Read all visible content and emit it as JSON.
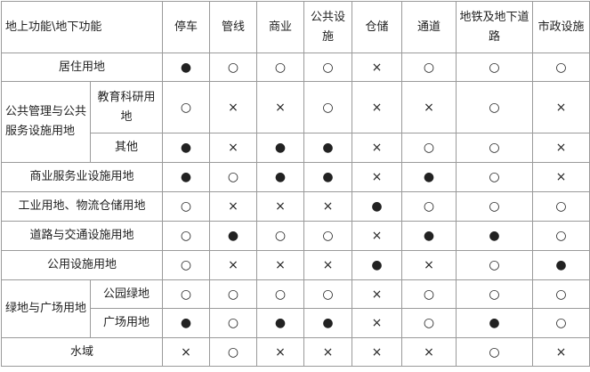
{
  "header": {
    "corner": "地上功能\\地下功能",
    "columns": [
      "停车",
      "管线",
      "商业",
      "公共设施",
      "仓储",
      "通道",
      "地铁及地下道路",
      "市政设施"
    ]
  },
  "groups": {
    "public": "公共管理与公共服务设施用地",
    "green": "绿地与广场用地"
  },
  "rows": [
    {
      "label": "居住用地",
      "marks": [
        "●",
        "○",
        "○",
        "○",
        "×",
        "○",
        "○",
        "○"
      ]
    },
    {
      "label": "教育科研用地",
      "marks": [
        "○",
        "×",
        "×",
        "○",
        "×",
        "×",
        "○",
        "×"
      ]
    },
    {
      "label": "其他",
      "marks": [
        "●",
        "×",
        "●",
        "●",
        "×",
        "○",
        "○",
        "×"
      ]
    },
    {
      "label": "商业服务业设施用地",
      "marks": [
        "●",
        "○",
        "●",
        "●",
        "×",
        "●",
        "○",
        "×"
      ]
    },
    {
      "label": "工业用地、物流仓储用地",
      "marks": [
        "○",
        "×",
        "×",
        "×",
        "●",
        "○",
        "○",
        "○"
      ]
    },
    {
      "label": "道路与交通设施用地",
      "marks": [
        "○",
        "●",
        "○",
        "○",
        "×",
        "●",
        "●",
        "○"
      ]
    },
    {
      "label": "公用设施用地",
      "marks": [
        "○",
        "×",
        "×",
        "×",
        "●",
        "×",
        "○",
        "●"
      ]
    },
    {
      "label": "公园绿地",
      "marks": [
        "○",
        "○",
        "○",
        "○",
        "×",
        "○",
        "○",
        "○"
      ]
    },
    {
      "label": "广场用地",
      "marks": [
        "●",
        "○",
        "●",
        "●",
        "×",
        "○",
        "●",
        "○"
      ]
    },
    {
      "label": "水域",
      "marks": [
        "×",
        "○",
        "×",
        "×",
        "×",
        "×",
        "○",
        "×"
      ]
    }
  ]
}
